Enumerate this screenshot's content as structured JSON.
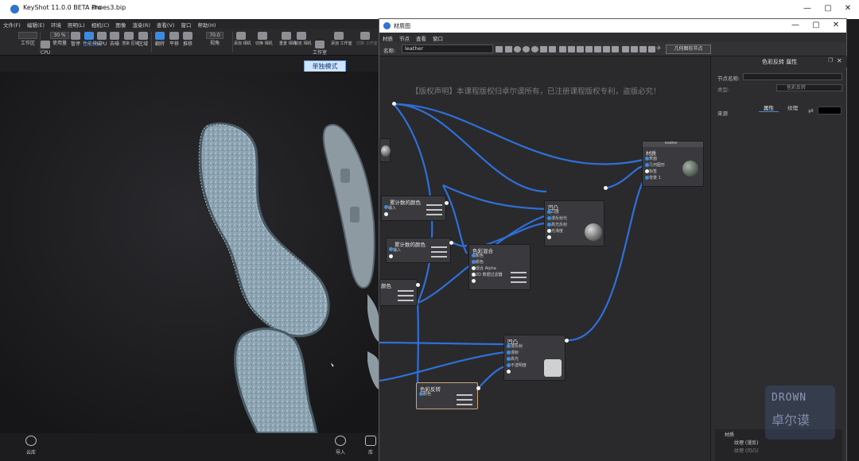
{
  "app": {
    "title": "KeyShot 11.0.0 BETA Pro",
    "file": "shoes3.bip",
    "menu": [
      "文件(F)",
      "编辑(E)",
      "环境",
      "照明(L)",
      "相机(C)",
      "图像",
      "渲染(R)",
      "查看(V)",
      "窗口",
      "帮助(H)"
    ],
    "toolbar": {
      "field1": "",
      "field2": "30 %",
      "field3": "70.0",
      "items": [
        "工作区",
        "CPU",
        "使用量",
        "暂停",
        "性能模式",
        "GPU",
        "去噪",
        "渲染 区域",
        "区域",
        "翻转",
        "平移",
        "推移",
        "视角",
        "添加 相机",
        "切换 相机",
        "重置 相机",
        "锁定 相机",
        "工作室",
        "添加 工作室",
        "切换 工作室"
      ]
    },
    "mode_label": "单独模式",
    "bottom": {
      "cloud": "云库",
      "import": "导入",
      "library": "库"
    },
    "window_controls": [
      "—",
      "▢",
      "✕"
    ]
  },
  "graph": {
    "title": "材质图",
    "menu": [
      "材质",
      "节点",
      "查看",
      "窗口"
    ],
    "name_label": "名称:",
    "name_value": "leather",
    "geom_button": "几何图形节点",
    "copyright": "【版权声明】本课程版权归卓尔谟所有，已注册课程版权专利，盗版必究！",
    "window_controls": [
      "—",
      "▢",
      "✕"
    ],
    "nodes": {
      "tex1": {
        "title": "累计数的颜色",
        "ports": [
          "输入",
          ""
        ]
      },
      "tex2": {
        "title": "累计数的颜色",
        "ports": [
          "输入",
          ""
        ]
      },
      "color": {
        "title": "颜色",
        "ports": []
      },
      "mix": {
        "title": "色彩混合",
        "ports": [
          "颜色",
          "颜色",
          "混合 Alpha",
          "2D 数据过滤器",
          ""
        ]
      },
      "bump": {
        "title": "凹凸",
        "ports": [
          "凸度",
          "漫反射光",
          "高光反射",
          "光滑度",
          ""
        ]
      },
      "output": {
        "title": "材质",
        "header": "leather",
        "ports": [
          "表面",
          "几何图形",
          "标签",
          "背景 1"
        ]
      },
      "mat2": {
        "title": "凹凸",
        "ports": [
          "漫反射",
          "漫射",
          "高光",
          "不透明度",
          ""
        ]
      },
      "cadj": {
        "title": "色彩反转",
        "ports": [
          "颜色"
        ]
      }
    }
  },
  "props": {
    "header": "色彩反转  属性",
    "node_name_label": "节点名称:",
    "type_label": "类型:",
    "type_value": "色彩反转",
    "tab_properties": "属性",
    "tab_texture": "纹理",
    "source_label": "来源",
    "tree": [
      "材质",
      "纹理 (漫反)",
      "纹理 (凹凸)"
    ]
  },
  "watermark": {
    "line1": "DROWN",
    "line2": "卓尔谟"
  }
}
